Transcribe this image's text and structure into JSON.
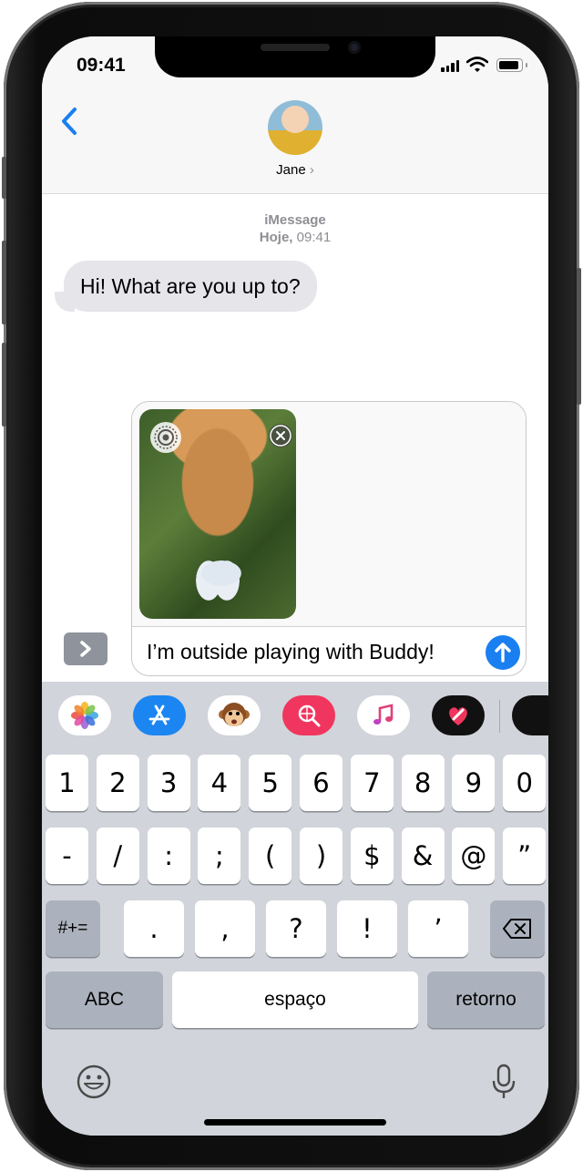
{
  "status_bar": {
    "time": "09:41"
  },
  "header": {
    "back_icon": "chevron-left-icon",
    "contact_name": "Jane",
    "contact_chevron": "›"
  },
  "conversation": {
    "service": "iMessage",
    "timestamp_day": "Hoje,",
    "timestamp_time": "09:41",
    "messages": [
      {
        "from": "Jane",
        "text": "Hi! What are you up to?"
      }
    ]
  },
  "compose": {
    "attachment_icons": {
      "live": "live-photo-icon",
      "remove": "remove-attachment-icon"
    },
    "text": "I’m outside playing with Buddy!",
    "send_icon": "send-arrow-icon",
    "expand_icon": "chevron-right-icon"
  },
  "app_strip": [
    {
      "name": "photos-app-icon"
    },
    {
      "name": "app-store-icon"
    },
    {
      "name": "animoji-icon"
    },
    {
      "name": "images-search-icon"
    },
    {
      "name": "music-icon"
    },
    {
      "name": "digital-touch-icon"
    },
    {
      "name": "more-apps-icon"
    }
  ],
  "keyboard": {
    "row1": [
      "1",
      "2",
      "3",
      "4",
      "5",
      "6",
      "7",
      "8",
      "9",
      "0"
    ],
    "row2": [
      "-",
      "/",
      ":",
      ";",
      "(",
      ")",
      "$",
      "&",
      "@",
      "”"
    ],
    "row3": [
      "#+=",
      ".",
      ",",
      "?",
      "!",
      "’"
    ],
    "row4": [
      "ABC",
      "espaço",
      "retorno"
    ],
    "delete_icon": "backspace-icon",
    "emoji_icon": "emoji-icon",
    "dictation_icon": "microphone-icon"
  },
  "colors": {
    "accent": "#1a7ff0",
    "bubble_incoming": "#e5e5ea",
    "keyboard_bg": "#d1d4da"
  }
}
